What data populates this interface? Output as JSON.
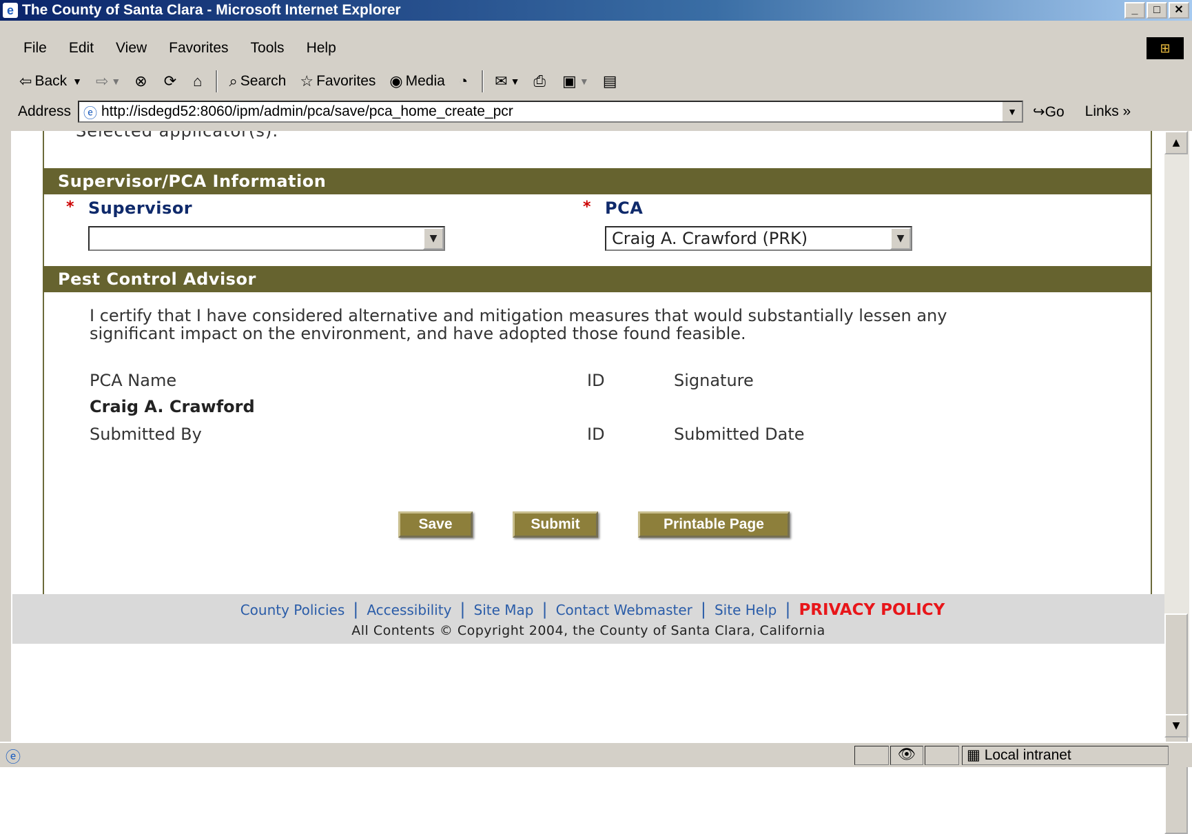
{
  "window": {
    "title": "The County of Santa Clara - Microsoft Internet Explorer",
    "min_glyph": "_",
    "max_glyph": "□",
    "close_glyph": "✕"
  },
  "menu": [
    "File",
    "Edit",
    "View",
    "Favorites",
    "Tools",
    "Help"
  ],
  "toolbar": {
    "back": "Back",
    "search": "Search",
    "favorites": "Favorites",
    "media": "Media"
  },
  "address": {
    "label": "Address",
    "url": "http://isdegd52:8060/ipm/admin/pca/save/pca_home_create_pcr",
    "go": "Go",
    "links": "Links"
  },
  "page": {
    "selected_applicators": "Selected applicator(s):",
    "supervisor_section": {
      "title": "Supervisor/PCA Information",
      "required_marker": "*",
      "supervisor_label": "Supervisor",
      "supervisor_value": "",
      "pca_label": "PCA",
      "pca_value": "Craig A. Crawford (PRK)"
    },
    "pca_section": {
      "title": "Pest Control Advisor",
      "certify_line1": "I certify that I have considered alternative and mitigation measures that would substantially lessen any",
      "certify_line2": "significant impact on the environment, and have adopted those found feasible.",
      "pca_name_label": "PCA Name",
      "id_label": "ID",
      "signature_label": "Signature",
      "pca_name_value": "Craig A. Crawford",
      "submitted_by_label": "Submitted By",
      "id_label_2": "ID",
      "submitted_date_label": "Submitted Date"
    },
    "buttons": {
      "save": "Save",
      "submit": "Submit",
      "printable": "Printable Page"
    }
  },
  "footer": {
    "links": [
      "County Policies",
      "Accessibility",
      "Site Map",
      "Contact Webmaster",
      "Site Help"
    ],
    "privacy": "PRIVACY POLICY",
    "copyright": "All Contents © Copyright 2004, the County of Santa Clara, California"
  },
  "status": {
    "zone": "Local intranet"
  },
  "colors": {
    "section_bar": "#66632f",
    "button": "#8d7f3b",
    "label_blue": "#0f2a6b",
    "required_red": "#cc0000",
    "privacy_red": "#e8161a",
    "link_blue": "#2a5ca8"
  }
}
